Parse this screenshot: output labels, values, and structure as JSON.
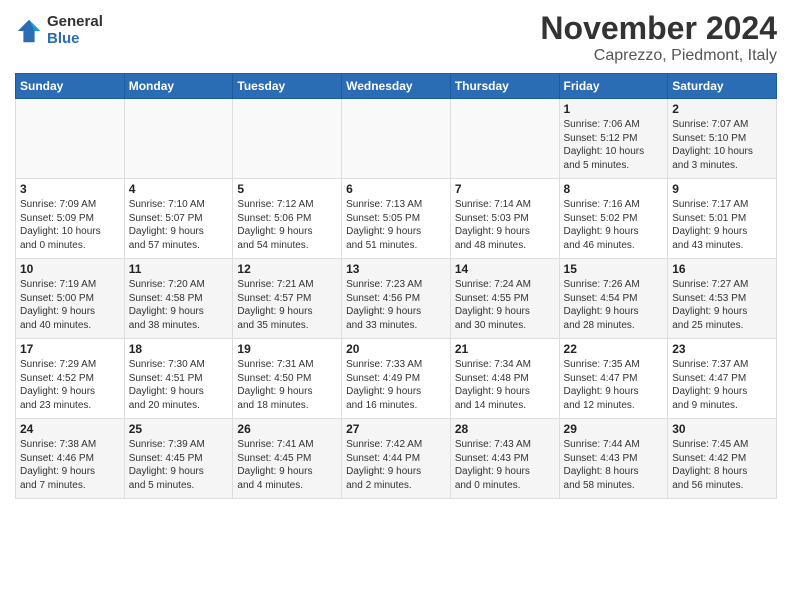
{
  "header": {
    "logo_line1": "General",
    "logo_line2": "Blue",
    "month_title": "November 2024",
    "location": "Caprezzo, Piedmont, Italy"
  },
  "weekdays": [
    "Sunday",
    "Monday",
    "Tuesday",
    "Wednesday",
    "Thursday",
    "Friday",
    "Saturday"
  ],
  "weeks": [
    [
      {
        "day": "",
        "info": ""
      },
      {
        "day": "",
        "info": ""
      },
      {
        "day": "",
        "info": ""
      },
      {
        "day": "",
        "info": ""
      },
      {
        "day": "",
        "info": ""
      },
      {
        "day": "1",
        "info": "Sunrise: 7:06 AM\nSunset: 5:12 PM\nDaylight: 10 hours\nand 5 minutes."
      },
      {
        "day": "2",
        "info": "Sunrise: 7:07 AM\nSunset: 5:10 PM\nDaylight: 10 hours\nand 3 minutes."
      }
    ],
    [
      {
        "day": "3",
        "info": "Sunrise: 7:09 AM\nSunset: 5:09 PM\nDaylight: 10 hours\nand 0 minutes."
      },
      {
        "day": "4",
        "info": "Sunrise: 7:10 AM\nSunset: 5:07 PM\nDaylight: 9 hours\nand 57 minutes."
      },
      {
        "day": "5",
        "info": "Sunrise: 7:12 AM\nSunset: 5:06 PM\nDaylight: 9 hours\nand 54 minutes."
      },
      {
        "day": "6",
        "info": "Sunrise: 7:13 AM\nSunset: 5:05 PM\nDaylight: 9 hours\nand 51 minutes."
      },
      {
        "day": "7",
        "info": "Sunrise: 7:14 AM\nSunset: 5:03 PM\nDaylight: 9 hours\nand 48 minutes."
      },
      {
        "day": "8",
        "info": "Sunrise: 7:16 AM\nSunset: 5:02 PM\nDaylight: 9 hours\nand 46 minutes."
      },
      {
        "day": "9",
        "info": "Sunrise: 7:17 AM\nSunset: 5:01 PM\nDaylight: 9 hours\nand 43 minutes."
      }
    ],
    [
      {
        "day": "10",
        "info": "Sunrise: 7:19 AM\nSunset: 5:00 PM\nDaylight: 9 hours\nand 40 minutes."
      },
      {
        "day": "11",
        "info": "Sunrise: 7:20 AM\nSunset: 4:58 PM\nDaylight: 9 hours\nand 38 minutes."
      },
      {
        "day": "12",
        "info": "Sunrise: 7:21 AM\nSunset: 4:57 PM\nDaylight: 9 hours\nand 35 minutes."
      },
      {
        "day": "13",
        "info": "Sunrise: 7:23 AM\nSunset: 4:56 PM\nDaylight: 9 hours\nand 33 minutes."
      },
      {
        "day": "14",
        "info": "Sunrise: 7:24 AM\nSunset: 4:55 PM\nDaylight: 9 hours\nand 30 minutes."
      },
      {
        "day": "15",
        "info": "Sunrise: 7:26 AM\nSunset: 4:54 PM\nDaylight: 9 hours\nand 28 minutes."
      },
      {
        "day": "16",
        "info": "Sunrise: 7:27 AM\nSunset: 4:53 PM\nDaylight: 9 hours\nand 25 minutes."
      }
    ],
    [
      {
        "day": "17",
        "info": "Sunrise: 7:29 AM\nSunset: 4:52 PM\nDaylight: 9 hours\nand 23 minutes."
      },
      {
        "day": "18",
        "info": "Sunrise: 7:30 AM\nSunset: 4:51 PM\nDaylight: 9 hours\nand 20 minutes."
      },
      {
        "day": "19",
        "info": "Sunrise: 7:31 AM\nSunset: 4:50 PM\nDaylight: 9 hours\nand 18 minutes."
      },
      {
        "day": "20",
        "info": "Sunrise: 7:33 AM\nSunset: 4:49 PM\nDaylight: 9 hours\nand 16 minutes."
      },
      {
        "day": "21",
        "info": "Sunrise: 7:34 AM\nSunset: 4:48 PM\nDaylight: 9 hours\nand 14 minutes."
      },
      {
        "day": "22",
        "info": "Sunrise: 7:35 AM\nSunset: 4:47 PM\nDaylight: 9 hours\nand 12 minutes."
      },
      {
        "day": "23",
        "info": "Sunrise: 7:37 AM\nSunset: 4:47 PM\nDaylight: 9 hours\nand 9 minutes."
      }
    ],
    [
      {
        "day": "24",
        "info": "Sunrise: 7:38 AM\nSunset: 4:46 PM\nDaylight: 9 hours\nand 7 minutes."
      },
      {
        "day": "25",
        "info": "Sunrise: 7:39 AM\nSunset: 4:45 PM\nDaylight: 9 hours\nand 5 minutes."
      },
      {
        "day": "26",
        "info": "Sunrise: 7:41 AM\nSunset: 4:45 PM\nDaylight: 9 hours\nand 4 minutes."
      },
      {
        "day": "27",
        "info": "Sunrise: 7:42 AM\nSunset: 4:44 PM\nDaylight: 9 hours\nand 2 minutes."
      },
      {
        "day": "28",
        "info": "Sunrise: 7:43 AM\nSunset: 4:43 PM\nDaylight: 9 hours\nand 0 minutes."
      },
      {
        "day": "29",
        "info": "Sunrise: 7:44 AM\nSunset: 4:43 PM\nDaylight: 8 hours\nand 58 minutes."
      },
      {
        "day": "30",
        "info": "Sunrise: 7:45 AM\nSunset: 4:42 PM\nDaylight: 8 hours\nand 56 minutes."
      }
    ]
  ]
}
